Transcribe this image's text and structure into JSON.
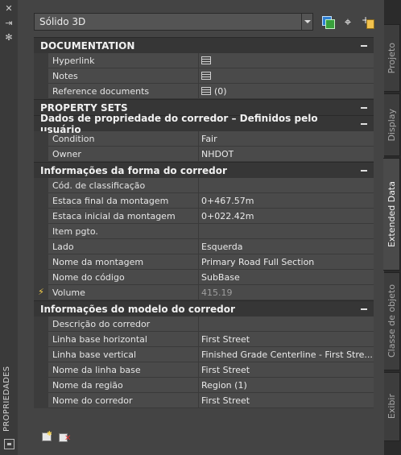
{
  "palette": {
    "title": "PROPRIEDADES"
  },
  "selector": {
    "value": "Sólido 3D"
  },
  "categories": [
    {
      "label": "DOCUMENTATION",
      "rows": [
        {
          "name": "Hyperlink",
          "value": "",
          "icon": "table-icon"
        },
        {
          "name": "Notes",
          "value": "",
          "icon": "table-icon"
        },
        {
          "name": "Reference documents",
          "value": "(0)",
          "icon": "table-icon"
        }
      ]
    },
    {
      "label": "PROPERTY SETS",
      "rows": []
    },
    {
      "label": "Dados de propriedade do corredor – Definidos pelo usuário",
      "rows": [
        {
          "name": "Condition",
          "value": "Fair"
        },
        {
          "name": "Owner",
          "value": "NHDOT"
        }
      ]
    },
    {
      "label": "Informações da forma do corredor",
      "rows": [
        {
          "name": "Cód. de classificação",
          "value": ""
        },
        {
          "name": "Estaca final da montagem",
          "value": "0+467.57m"
        },
        {
          "name": "Estaca inicial da montagem",
          "value": "0+022.42m"
        },
        {
          "name": "Item pgto.",
          "value": ""
        },
        {
          "name": "Lado",
          "value": "Esquerda"
        },
        {
          "name": "Nome da montagem",
          "value": "Primary Road Full Section"
        },
        {
          "name": "Nome do código",
          "value": "SubBase"
        },
        {
          "name": "Volume",
          "value": "415.19",
          "formula": true,
          "dim": true
        }
      ]
    },
    {
      "label": "Informações do modelo do corredor",
      "rows": [
        {
          "name": "Descrição do corredor",
          "value": ""
        },
        {
          "name": "Linha base horizontal",
          "value": "First Street"
        },
        {
          "name": "Linha base vertical",
          "value": "Finished Grade Centerline - First Stre..."
        },
        {
          "name": "Nome da linha base",
          "value": "First Street"
        },
        {
          "name": "Nome da região",
          "value": "Region (1)"
        },
        {
          "name": "Nome do corredor",
          "value": "First Street"
        }
      ]
    }
  ],
  "tabs": [
    {
      "label": "Projeto",
      "active": false
    },
    {
      "label": "Display",
      "active": false
    },
    {
      "label": "Extended Data",
      "active": true
    },
    {
      "label": "Classe de objeto",
      "active": false
    },
    {
      "label": "Exibir",
      "active": false
    }
  ]
}
